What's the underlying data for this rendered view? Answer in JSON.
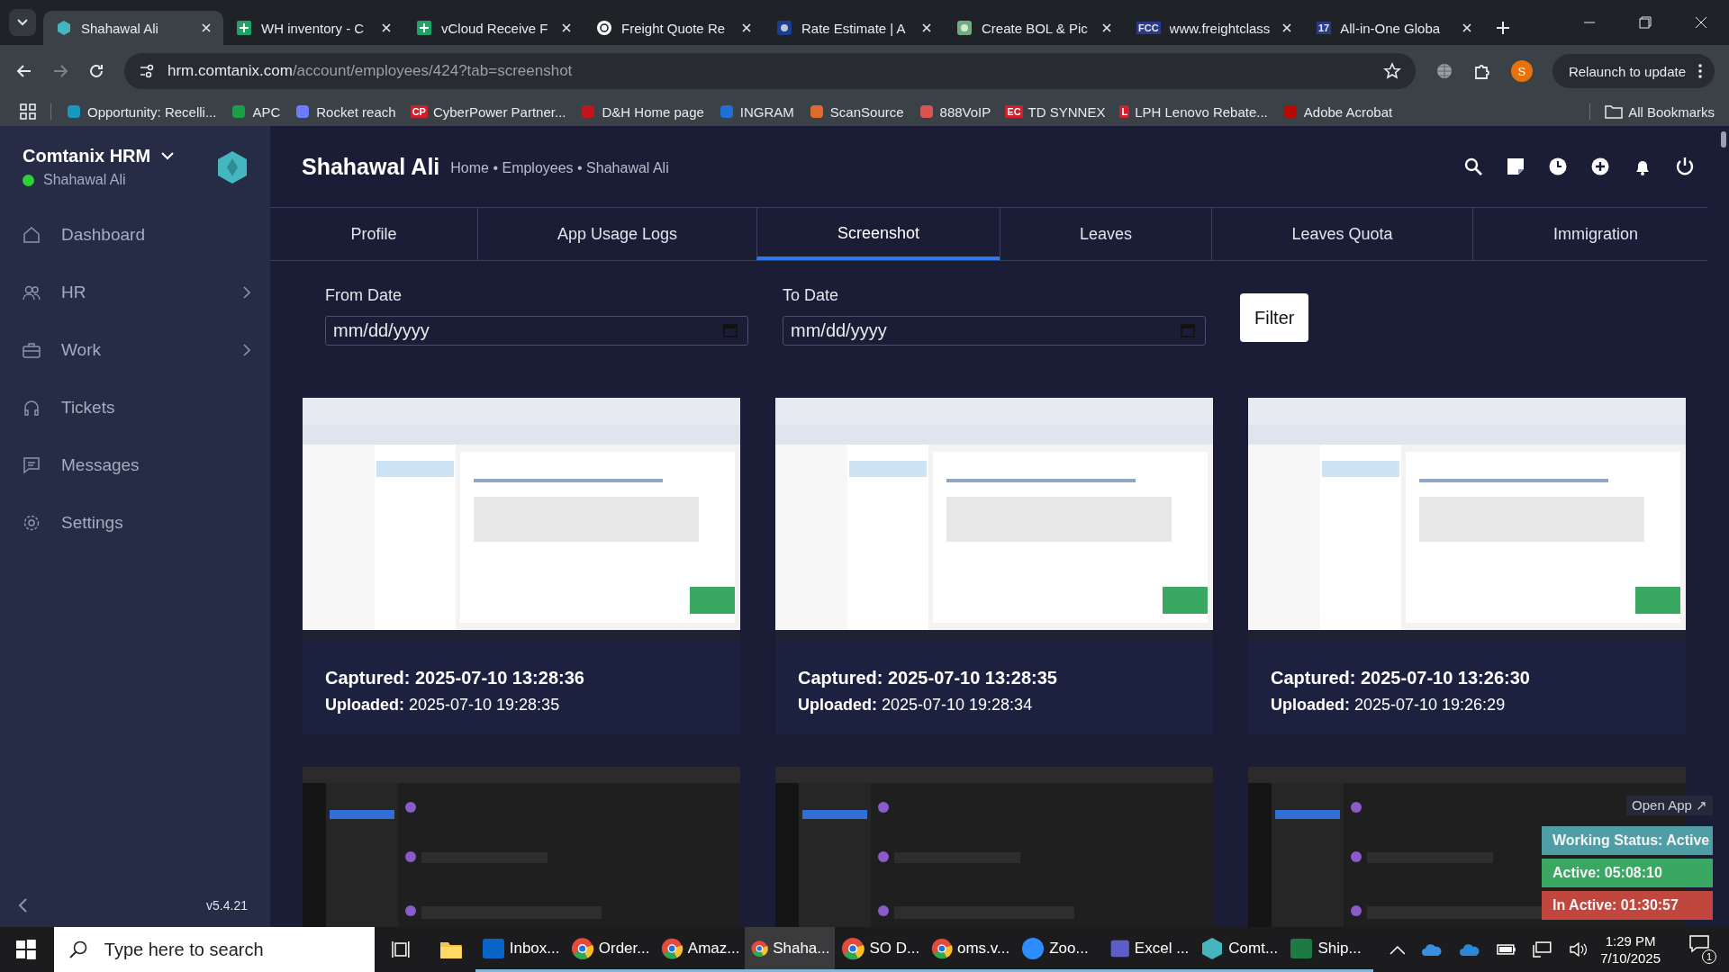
{
  "browser": {
    "tabs": [
      {
        "title": "Shahawal Ali",
        "kind": "hex",
        "selected": true
      },
      {
        "title": "WH inventory - C",
        "kind": "sheet",
        "selected": false
      },
      {
        "title": "vCloud Receive F",
        "kind": "sheet",
        "selected": false
      },
      {
        "title": "Freight Quote Re",
        "kind": "knot",
        "selected": false
      },
      {
        "title": "Rate Estimate | A",
        "kind": "act",
        "selected": false
      },
      {
        "title": "Create BOL & Pic",
        "kind": "coin",
        "selected": false
      },
      {
        "title": "www.freightclass",
        "kind": "text",
        "icon_text": "FCC",
        "selected": false
      },
      {
        "title": "All-in-One Globa",
        "kind": "text",
        "icon_text": "17",
        "selected": false
      }
    ],
    "url_host": "hrm.comtanix.com",
    "url_path": "/account/employees/424?tab=screenshot",
    "profile_initial": "S",
    "relaunch": "Relaunch to update",
    "bookmarks": [
      {
        "label": "Opportunity: Recelli...",
        "kind": "cloud"
      },
      {
        "label": "APC",
        "kind": "swoosh"
      },
      {
        "label": "Rocket reach",
        "kind": "rocket"
      },
      {
        "label": "CyberPower Partner...",
        "kind": "text",
        "icon_text": "CP"
      },
      {
        "label": "D&H Home page",
        "kind": "flag"
      },
      {
        "label": "INGRAM",
        "kind": "g"
      },
      {
        "label": "ScanSource",
        "kind": "cube"
      },
      {
        "label": "888VoIP",
        "kind": "people"
      },
      {
        "label": "TD SYNNEX",
        "kind": "text",
        "icon_text": "EC"
      },
      {
        "label": "LPH Lenovo Rebate...",
        "kind": "text",
        "icon_text": "L"
      },
      {
        "label": "Adobe Acrobat",
        "kind": "pdf"
      }
    ],
    "all_bookmarks": "All Bookmarks"
  },
  "sidebar": {
    "app_name": "Comtanix HRM",
    "user": "Shahawal Ali",
    "online": true,
    "version": "v5.4.21",
    "items": [
      {
        "label": "Dashboard",
        "kind": "home",
        "arrow": false
      },
      {
        "label": "HR",
        "kind": "people",
        "arrow": true
      },
      {
        "label": "Work",
        "kind": "briefcase",
        "arrow": true
      },
      {
        "label": "Tickets",
        "kind": "headset",
        "arrow": false
      },
      {
        "label": "Messages",
        "kind": "message",
        "arrow": false
      },
      {
        "label": "Settings",
        "kind": "gear",
        "arrow": false
      }
    ]
  },
  "header": {
    "title": "Shahawal Ali",
    "breadcrumb": "Home • Employees • Shahawal Ali"
  },
  "page_tabs": [
    {
      "label": "Profile",
      "selected": false
    },
    {
      "label": "App Usage Logs",
      "selected": false
    },
    {
      "label": "Screenshot",
      "selected": true
    },
    {
      "label": "Leaves",
      "selected": false
    },
    {
      "label": "Leaves Quota",
      "selected": false
    },
    {
      "label": "Immigration",
      "selected": false
    }
  ],
  "filter": {
    "from_label": "From Date",
    "from_placeholder": "mm/dd/yyyy",
    "to_label": "To Date",
    "to_placeholder": "mm/dd/yyyy",
    "button": "Filter"
  },
  "screenshots": [
    {
      "kind": "picture",
      "captured_label": "Captured:",
      "captured": "2025-07-10 13:28:36",
      "uploaded_label": "Uploaded:",
      "uploaded": "2025-07-10 19:28:35"
    },
    {
      "kind": "picture",
      "captured_label": "Captured:",
      "captured": "2025-07-10 13:28:35",
      "uploaded_label": "Uploaded:",
      "uploaded": "2025-07-10 19:28:34"
    },
    {
      "kind": "picture",
      "captured_label": "Captured:",
      "captured": "2025-07-10 13:26:30",
      "uploaded_label": "Uploaded:",
      "uploaded": "2025-07-10 19:26:29"
    },
    {
      "kind": "picture"
    },
    {
      "kind": "picture"
    },
    {
      "kind": "picture"
    }
  ],
  "tracker": {
    "open_app": "Open App ↗",
    "statuses": [
      {
        "label": "Working Status: Active",
        "color": "#4f9ea5"
      },
      {
        "label": "Active: 05:08:10",
        "color": "#3aa862"
      },
      {
        "label": "In Active: 01:30:57",
        "color": "#c1463e"
      }
    ]
  },
  "taskbar": {
    "search_placeholder": "Type here to search",
    "apps": [
      {
        "label": "Inbox...",
        "kind": "outlook",
        "selected": false
      },
      {
        "label": "Order...",
        "kind": "chrome",
        "selected": false
      },
      {
        "label": "Amaz...",
        "kind": "chrome",
        "selected": false
      },
      {
        "label": "Shaha...",
        "kind": "chrome",
        "selected": true
      },
      {
        "label": "SO D...",
        "kind": "chrome",
        "selected": false
      },
      {
        "label": "oms.v...",
        "kind": "chrome",
        "selected": false
      },
      {
        "label": "Zoo...",
        "kind": "zoom",
        "selected": false
      },
      {
        "label": "Excel ...",
        "kind": "teams",
        "selected": false
      },
      {
        "label": "Comt...",
        "kind": "hex",
        "selected": false
      },
      {
        "label": "Ship...",
        "kind": "excel",
        "selected": false
      }
    ],
    "time": "1:29 PM",
    "date": "7/10/2025",
    "notifications": "1"
  }
}
